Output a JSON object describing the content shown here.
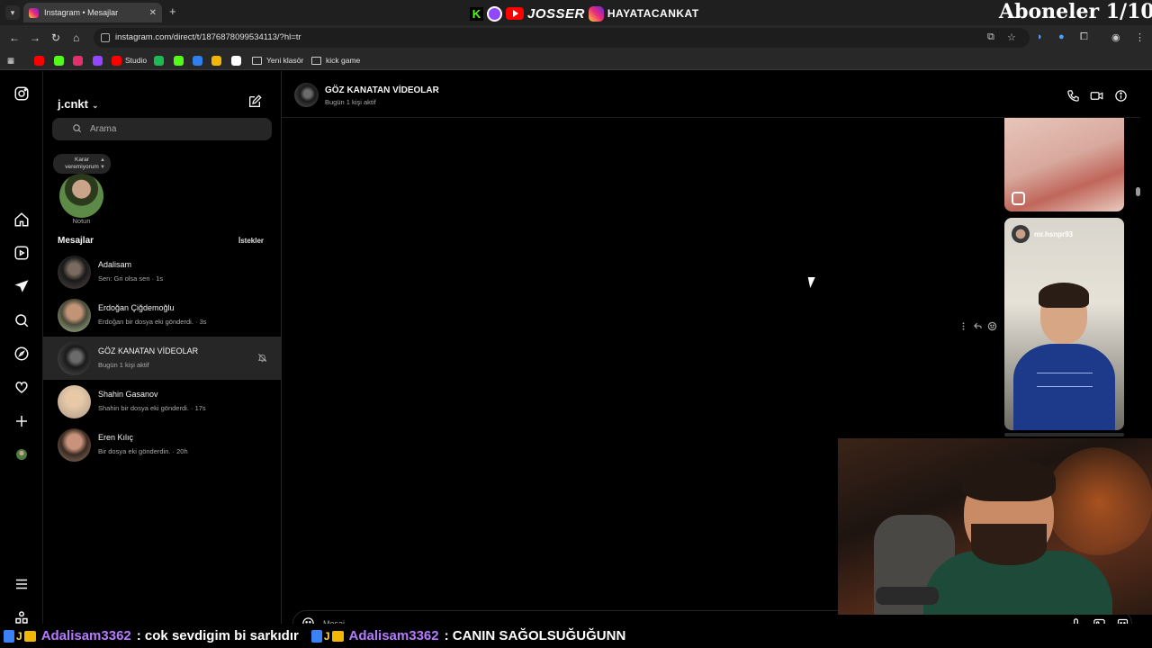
{
  "browser": {
    "tab_title": "Instagram • Mesajlar",
    "url": "instagram.com/direct/t/1876878099534113/?hl=tr",
    "bookmarks": [
      {
        "label": "",
        "color": "#ff0000"
      },
      {
        "label": "",
        "color": "#53fc18"
      },
      {
        "label": "",
        "color": "#e1306c"
      },
      {
        "label": "",
        "color": "#9146ff"
      },
      {
        "label": "Studio",
        "color": "#ff0000"
      },
      {
        "label": "",
        "color": "#1db954"
      },
      {
        "label": "",
        "color": "#53fc18"
      },
      {
        "label": "",
        "color": "#2f80ed"
      },
      {
        "label": "",
        "color": "#f2b705"
      },
      {
        "label": "",
        "color": "#ffffff"
      },
      {
        "label": "Yeni klasör",
        "folder": true
      },
      {
        "label": "kick game",
        "folder": true
      }
    ]
  },
  "stream_overlay": {
    "brand": "JOSSER",
    "handle": "HAYATACANKAT",
    "subs_goal": "Aboneler 1/10"
  },
  "instagram": {
    "account": "j.cnkt",
    "search_placeholder": "Arama",
    "note": {
      "text_line1": "Karar",
      "text_line2": "veremiyorum",
      "label": "Notun"
    },
    "messages_heading": "Mesajlar",
    "requests_label": "İstekler",
    "threads": [
      {
        "name": "Adalisam",
        "preview": "Sen: Gri olsa sen · 1s",
        "active": false,
        "muted": false
      },
      {
        "name": "Erdoğan Çiğdemoğlu",
        "preview": "Erdoğan bir dosya eki gönderdi. · 3s",
        "active": false,
        "muted": false
      },
      {
        "name": "GÖZ KANATAN VİDEOLAR",
        "preview": "Bugün 1 kişi aktif",
        "active": true,
        "muted": true
      },
      {
        "name": "Shahin Gasanov",
        "preview": "Shahin bir dosya eki gönderdi. · 17s",
        "active": false,
        "muted": false
      },
      {
        "name": "Eren Kılıç",
        "preview": "Bir dosya eki gönderdin. · 20h",
        "active": false,
        "muted": false
      }
    ],
    "chat": {
      "title": "GÖZ KANATAN VİDEOLAR",
      "status": "Bugün 1 kişi aktif",
      "shared_post_user": "mr.hsnpr93",
      "message_placeholder": "Mesaj..."
    }
  },
  "ticker": [
    {
      "user": "Adalisam3362",
      "text": ": cok sevdigim bi sarkıdır"
    },
    {
      "user": "Adalisam3362",
      "text": ": CANIN SAĞOLSUĞUĞUNN"
    }
  ]
}
